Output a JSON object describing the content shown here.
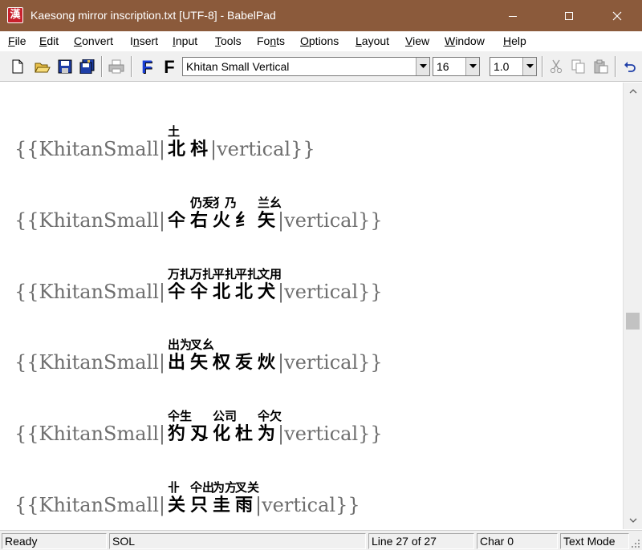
{
  "window": {
    "title": "Kaesong mirror inscription.txt [UTF-8] - BabelPad",
    "app_icon_glyph": "漢"
  },
  "menu": [
    {
      "label": "File",
      "access": "F",
      "rest": "ile"
    },
    {
      "label": "Edit",
      "access": "E",
      "rest": "dit"
    },
    {
      "label": "Convert",
      "access": "C",
      "rest": "onvert"
    },
    {
      "label": "Insert",
      "pre": "I",
      "access": "n",
      "rest": "sert"
    },
    {
      "label": "Input",
      "access": "I",
      "rest": "nput"
    },
    {
      "label": "Tools",
      "access": "T",
      "rest": "ools"
    },
    {
      "label": "Fonts",
      "pre": "Fo",
      "access": "n",
      "rest": "ts"
    },
    {
      "label": "Options",
      "access": "O",
      "rest": "ptions"
    },
    {
      "label": "Layout",
      "access": "L",
      "rest": "ayout"
    },
    {
      "label": "View",
      "access": "V",
      "rest": "iew"
    },
    {
      "label": "Window",
      "access": "W",
      "rest": "indow"
    },
    {
      "label": "Help",
      "access": "H",
      "rest": "elp"
    }
  ],
  "toolbar": {
    "font_name": "Khitan Small Vertical",
    "font_size": "16",
    "line_spacing": "1.0",
    "font_button_blue": "F",
    "font_button_black": "F",
    "colors": {
      "blue_f": "#1a3fd6",
      "accent": "#0a5fd7"
    }
  },
  "editor": {
    "lines": [
      {
        "prefix": "{{KhitanSmall|",
        "suffix": "|vertical}}",
        "glyphs": [
          {
            "main": "北",
            "upper": "土"
          },
          {
            "main": "枓",
            "upper": ""
          }
        ]
      },
      {
        "prefix": "{{KhitanSmall|",
        "suffix": "|vertical}}",
        "glyphs": [
          {
            "main": "仐",
            "upper": ""
          },
          {
            "main": "右",
            "upper": "仍叐"
          },
          {
            "main": "火",
            "upper": "犭乃"
          },
          {
            "main": "纟",
            "upper": ""
          },
          {
            "main": "矢",
            "upper": "兰幺"
          }
        ]
      },
      {
        "prefix": "{{KhitanSmall|",
        "suffix": "|vertical}}",
        "glyphs": [
          {
            "main": "仐",
            "upper": "万扎"
          },
          {
            "main": "仐",
            "upper": "万扎"
          },
          {
            "main": "北",
            "upper": "平扎"
          },
          {
            "main": "北",
            "upper": "平扎"
          },
          {
            "main": "犬",
            "upper": "文用"
          }
        ]
      },
      {
        "prefix": "{{KhitanSmall|",
        "suffix": "|vertical}}",
        "glyphs": [
          {
            "main": "出",
            "upper": "出为"
          },
          {
            "main": "矢",
            "upper": "叉幺"
          },
          {
            "main": "权",
            "upper": ""
          },
          {
            "main": "叐",
            "upper": ""
          },
          {
            "main": "炏",
            "upper": ""
          }
        ]
      },
      {
        "prefix": "{{KhitanSmall|",
        "suffix": "|vertical}}",
        "glyphs": [
          {
            "main": "犳",
            "upper": "仐生"
          },
          {
            "main": "刄",
            "upper": ""
          },
          {
            "main": "化",
            "upper": "公司"
          },
          {
            "main": "杜",
            "upper": ""
          },
          {
            "main": "为",
            "upper": "仐欠"
          }
        ]
      },
      {
        "prefix": "{{KhitanSmall|",
        "suffix": "|vertical}}",
        "glyphs": [
          {
            "main": "关",
            "upper": "卝"
          },
          {
            "main": "只",
            "upper": "仐出"
          },
          {
            "main": "圭",
            "upper": "为方"
          },
          {
            "main": "雨",
            "upper": "叉关"
          }
        ]
      }
    ]
  },
  "status": {
    "ready": "Ready",
    "mode": "SOL",
    "line": "Line 27 of 27",
    "char": "Char 0",
    "text_mode": "Text Mode"
  }
}
